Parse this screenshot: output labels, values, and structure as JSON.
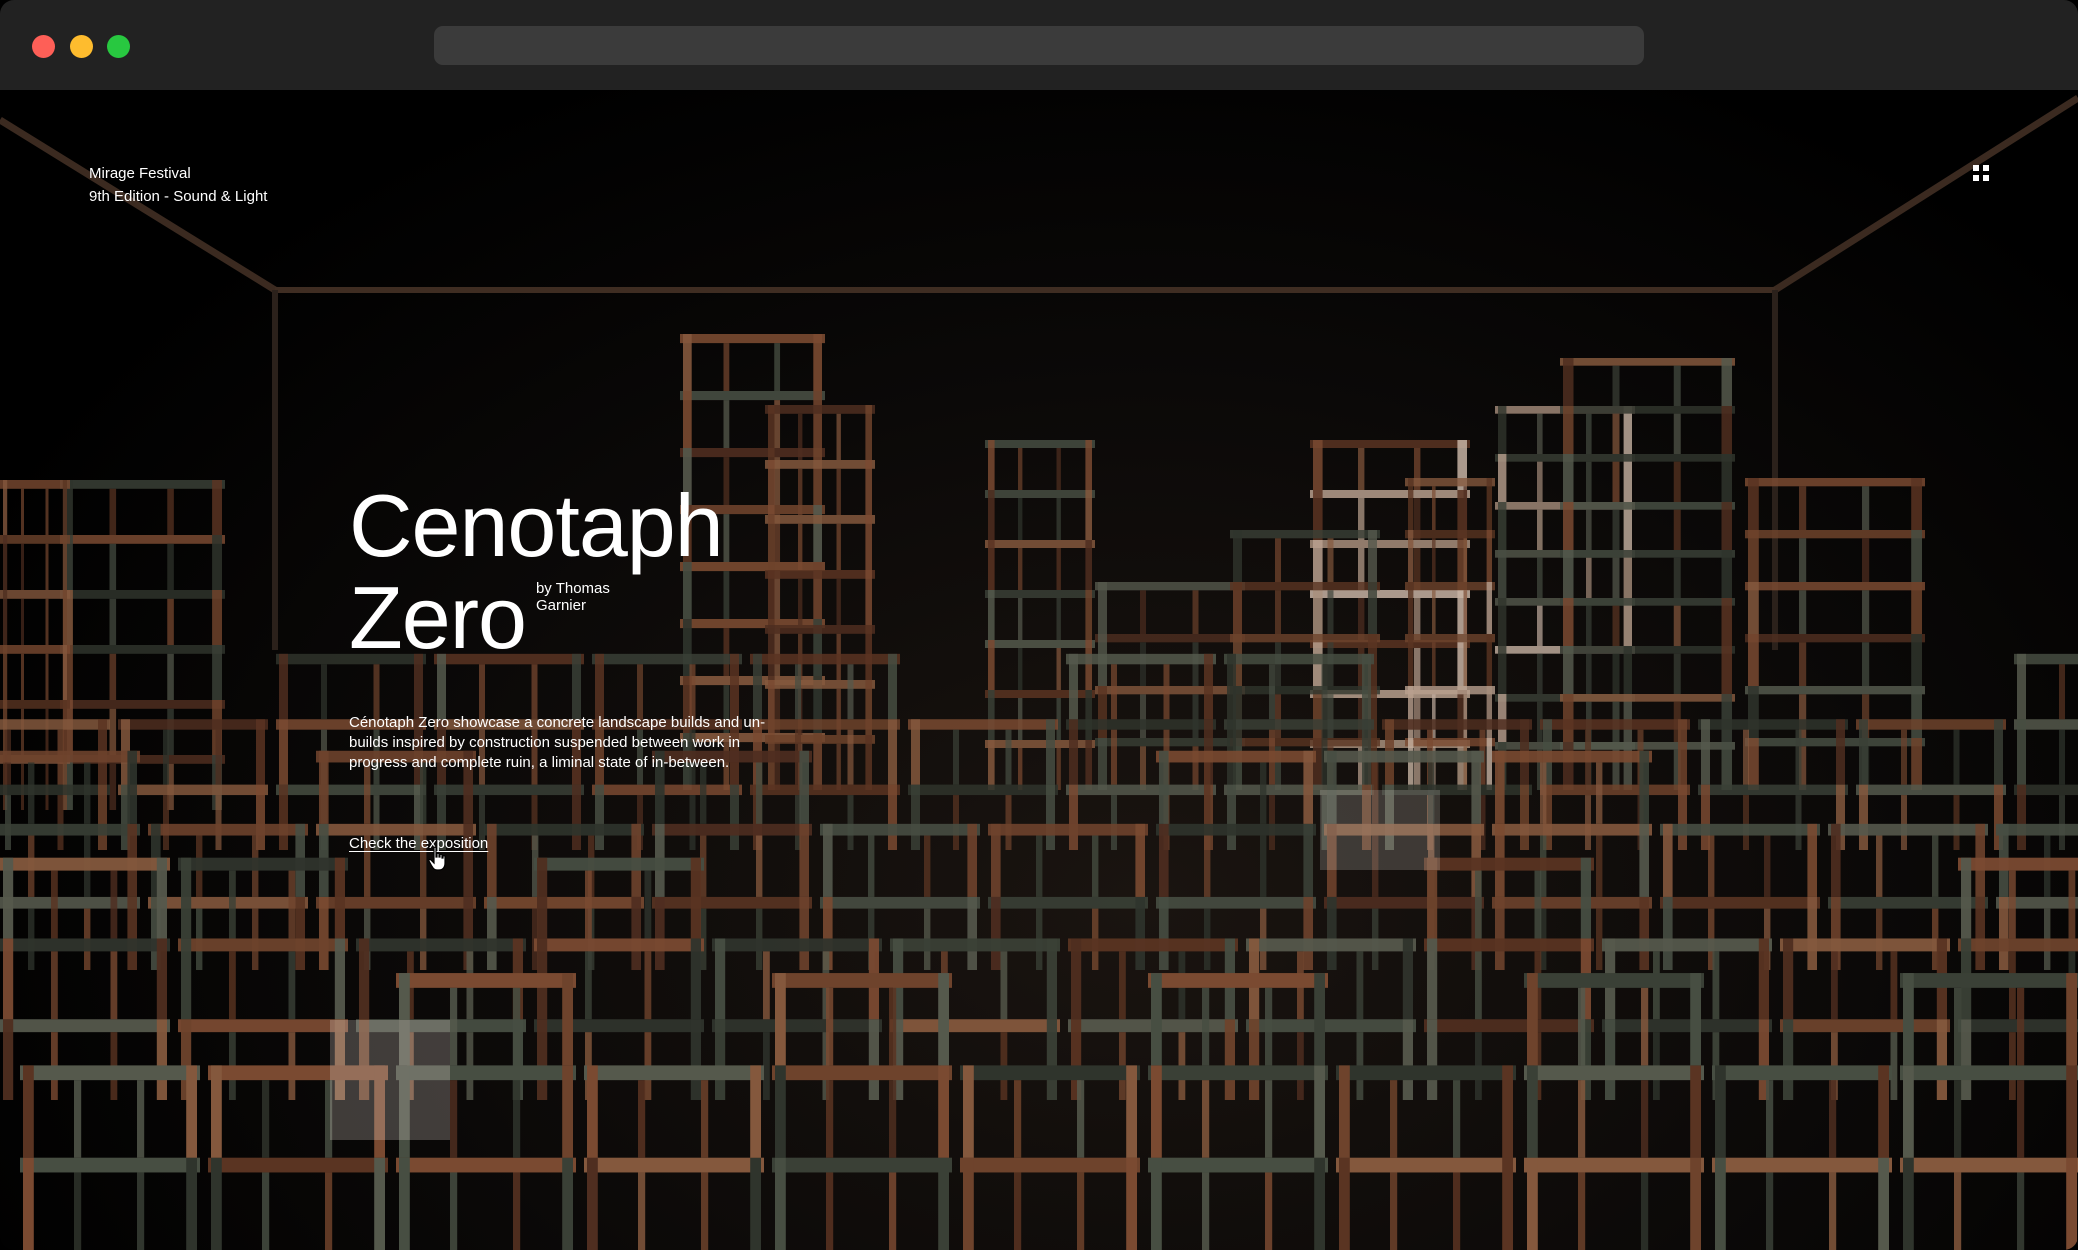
{
  "browser": {
    "traffic_lights": [
      "close",
      "minimize",
      "maximize"
    ],
    "colors": {
      "close": "#fe5f57",
      "minimize": "#febc2e",
      "maximize": "#28c840"
    },
    "url": ""
  },
  "site": {
    "brand": {
      "name": "Mirage Festival",
      "edition": "9th Edition - Sound & Light"
    },
    "menu_icon": "grid-menu-icon"
  },
  "hero": {
    "title_line1": "Cenotaph",
    "title_line2": "Zero",
    "byline": "by Thomas Garnier",
    "description": "Cénotaph Zero showcase a concrete landscape builds and un-builds inspired by construction suspended between work in progress and complete ruin, a liminal state of in-between.",
    "cta_label": "Check the exposition"
  },
  "colors": {
    "background": "#000000",
    "text": "#ffffff",
    "rust": "#6b3f2a",
    "steel": "#3d4338"
  }
}
